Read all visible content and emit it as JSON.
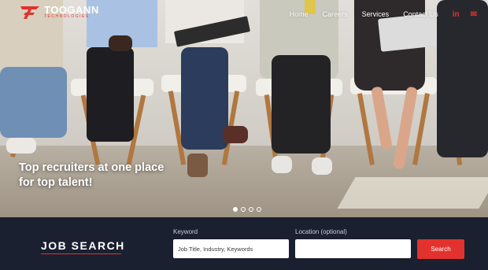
{
  "brand": {
    "name": "TOOGANN",
    "tagline": "TECHNOLOGIES",
    "accent": "#e2322d"
  },
  "nav": {
    "items": [
      {
        "label": "Home"
      },
      {
        "label": "Careers"
      },
      {
        "label": "Services"
      },
      {
        "label": "Contact Us"
      }
    ],
    "social": [
      {
        "icon": "linkedin-icon",
        "text": "in"
      },
      {
        "icon": "mail-icon",
        "text": "✉"
      }
    ]
  },
  "hero": {
    "headline": "Top recruiters at one place for top talent!",
    "slides": 4,
    "active_slide": 1
  },
  "job_search": {
    "title": "JOB SEARCH",
    "keyword_label": "Keyword",
    "keyword_placeholder": "Job Title, Industry, Keywords",
    "location_label": "Location (optional)",
    "location_placeholder": "",
    "search_button": "Search"
  },
  "colors": {
    "footer_bg": "#1b2030",
    "accent": "#e2322d"
  }
}
